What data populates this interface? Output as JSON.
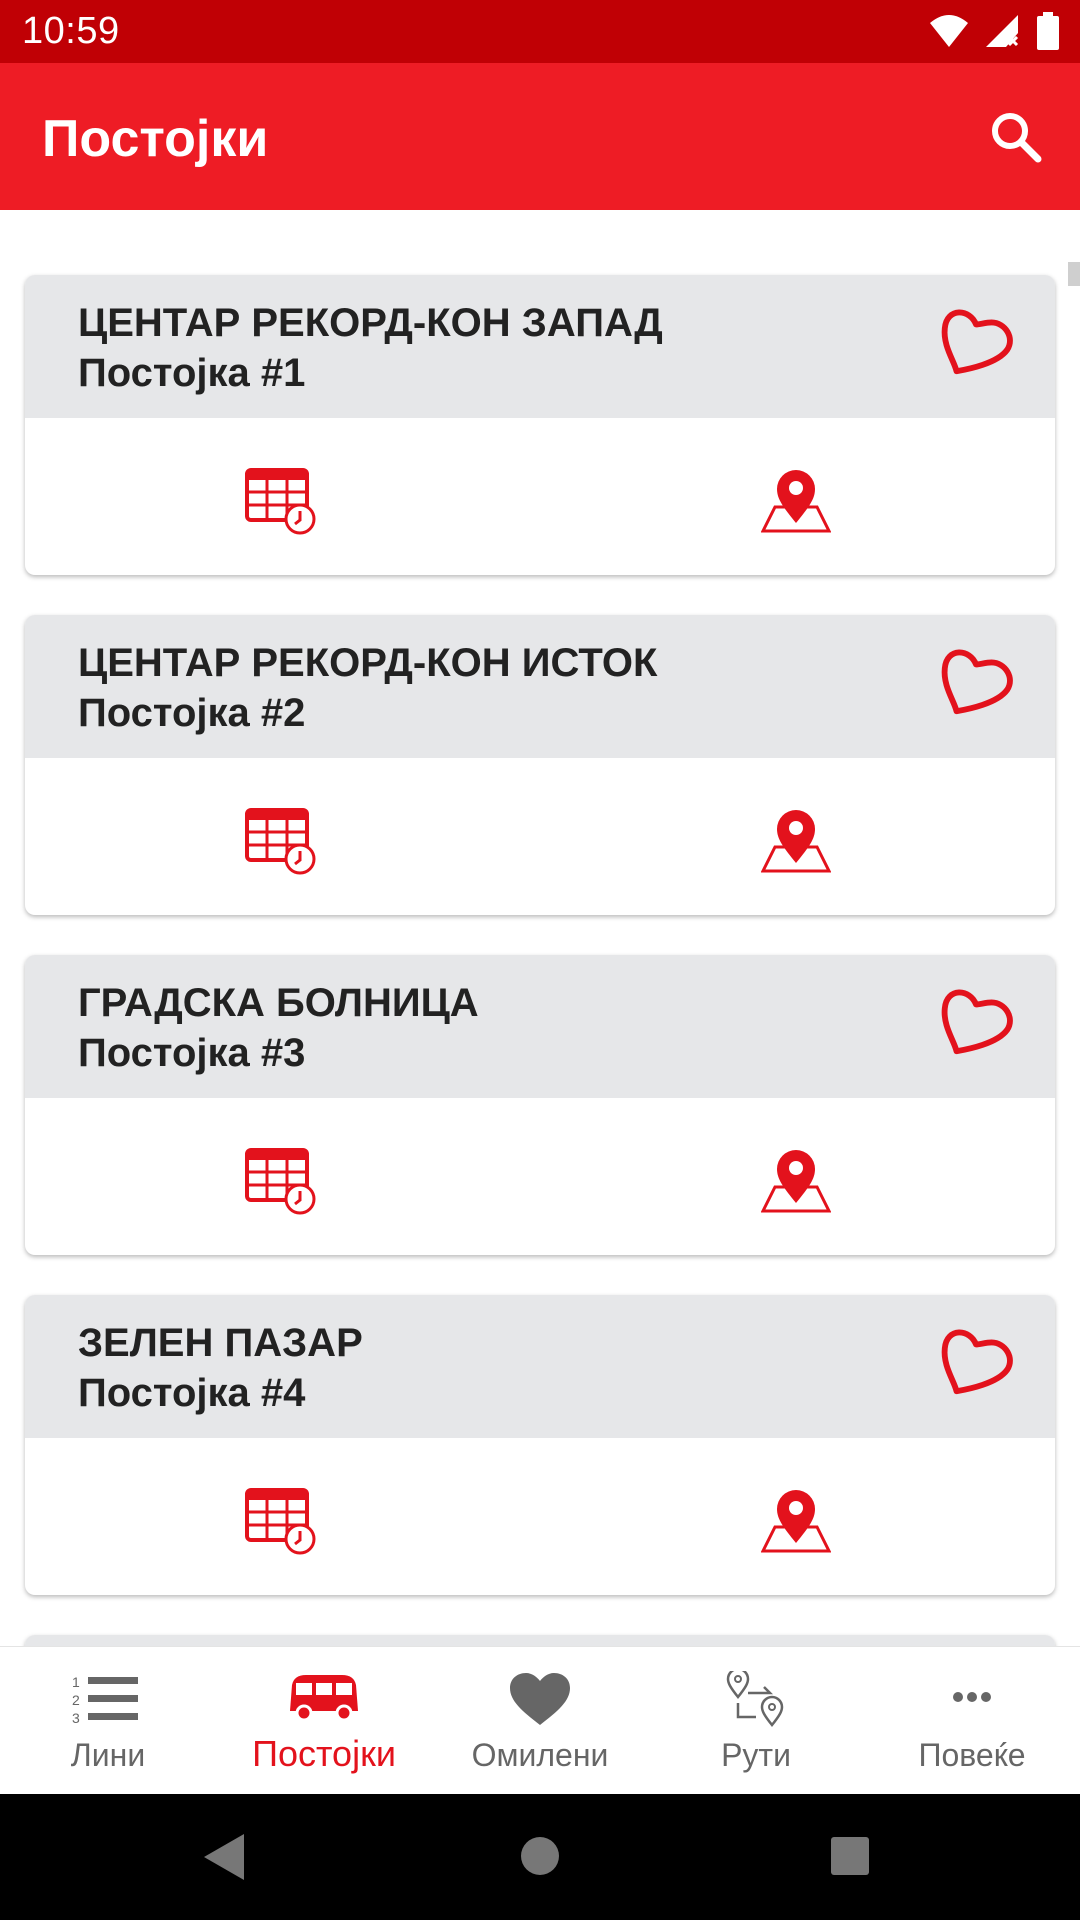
{
  "status_bar": {
    "time": "10:59"
  },
  "app_bar": {
    "title": "Постојки",
    "search_icon": "search-icon"
  },
  "colors": {
    "primary": "#ee1c25",
    "status": "#c00005",
    "card_header": "#e6e7e9",
    "active": "#e3121c"
  },
  "stops": [
    {
      "name": "ЦЕНТАР РЕКОРД-КОН ЗАПАД",
      "number": "Постојка #1"
    },
    {
      "name": "ЦЕНТАР РЕКОРД-КОН ИСТОК",
      "number": "Постојка #2"
    },
    {
      "name": "ГРАДСКА БОЛНИЦА",
      "number": "Постојка #3"
    },
    {
      "name": "ЗЕЛЕН ПАЗАР",
      "number": "Постојка #4"
    }
  ],
  "bottom_nav": [
    {
      "label": "Лини",
      "icon": "numbered-list-icon",
      "active": false
    },
    {
      "label": "Постојки",
      "icon": "bus-icon",
      "active": true
    },
    {
      "label": "Омилени",
      "icon": "heart-icon",
      "active": false
    },
    {
      "label": "Рути",
      "icon": "route-icon",
      "active": false
    },
    {
      "label": "Повеќе",
      "icon": "more-icon",
      "active": false
    }
  ]
}
